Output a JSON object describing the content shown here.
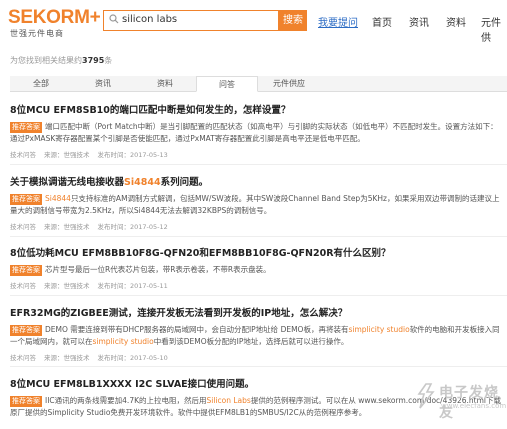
{
  "header": {
    "logo": "SEKORM",
    "logo_plus": "+",
    "logo_sub": "世强元件电商",
    "search_value": "silicon labs",
    "search_button": "搜索",
    "ask_link": "我要提问",
    "nav": [
      "首页",
      "资讯",
      "资料",
      "元件供"
    ]
  },
  "results_summary": {
    "prefix": "为您找到相关结果约",
    "count": "3795",
    "suffix": "条"
  },
  "tabs": [
    {
      "label": "全部",
      "active": false
    },
    {
      "label": "资讯",
      "active": false
    },
    {
      "label": "资料",
      "active": false
    },
    {
      "label": "问答",
      "active": true
    },
    {
      "label": "元件供应",
      "active": false
    }
  ],
  "results": [
    {
      "title": "8位MCU EFM8SB10的端口匹配中断是如何发生的，怎样设置？",
      "tag": "推荐答案",
      "body": "端口匹配中断（Port Match中断）是当引脚配置的匹配状态（如高电平）与引脚的实际状态（如低电平）不匹配时发生。设置方法如下：通过PxMASK寄存器配置某个引脚是否使能匹配，通过PxMAT寄存器配置此引脚是高电平还是低电平匹配。",
      "author": "技术问答",
      "source": "来源：世强技术",
      "date": "发布时间：2017-05-13"
    },
    {
      "title_before": "关于模拟调谐无线电接收器",
      "title_hl": "Si4844",
      "title_after": "系列问题。",
      "tag": "推荐答案",
      "body_hl": "Si4844",
      "body": "只支持标准的AM调制方式解调，包括MW/SW波段。其中SW波段Channel Band Step为5KHz，如果采用双边带调制的话建议上量大的调制信号带宽为2.5KHz，所以Si4844无法去解调32KBPS的调制信号。",
      "author": "技术问答",
      "source": "来源：世强技术",
      "date": "发布时间：2017-05-12"
    },
    {
      "title": "8位低功耗MCU EFM8BB10F8G-QFN20和EFM8BB10F8G-QFN20R有什么区别？",
      "tag": "推荐答案",
      "body": "芯片型号最后一位R代表芯片包装，带R表示卷装，不带R表示盘装。",
      "author": "技术问答",
      "source": "来源：世强技术",
      "date": "发布时间：2017-05-11"
    },
    {
      "title": "EFR32MG的ZIGBEE测试，连接开发板无法看到开发板的IP地址，怎么解决？",
      "tag": "推荐答案",
      "body_a": "DEMO 需要连接到带有DHCP服务器的局域网中，会自动分配IP地址给 DEMO板，再将装有",
      "body_hl1": "simplicity studio",
      "body_b": "软件的电脑和开发板接入同一个局域网内，就可以在",
      "body_hl2": "simplicity studio",
      "body_c": "中看到该DEMO板分配的IP地址，选择后就可以进行操作。",
      "author": "技术问答",
      "source": "来源：世强技术",
      "date": "发布时间：2017-05-10"
    },
    {
      "title": "8位MCU EFM8LB1XXXX I2C SLVAE接口使用问题。",
      "tag": "推荐答案",
      "body_a": "IIC通讯的两条线需要加4.7K的上拉电阻，然后用",
      "body_hl": "Silicon Labs",
      "body_b": "提供的范例程序测试。可以在从 www.sekorm.com/doc/43926.html下载原厂提供的Simplicity Studio免费开发环境软件。软件中提供EFM8LB1的SMBUS/I2C从的范例程序参考。"
    }
  ],
  "watermark": {
    "text": "电子发烧友",
    "url": "www.elecfans.com"
  },
  "colors": {
    "brand": "#f0822c",
    "link": "#2b6bc4"
  }
}
